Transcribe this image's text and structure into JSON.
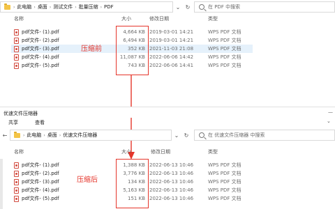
{
  "colors": {
    "accent_red": "#e5352b",
    "selected_row": "#e5f1fb",
    "folder": "#f3c447",
    "pdf_icon": "#d24a3e"
  },
  "top": {
    "breadcrumb": [
      "此电脑",
      "桌面",
      "测试文件",
      "批量压缩",
      "PDF"
    ],
    "search_placeholder": "在 PDF 中搜索",
    "columns": {
      "name": "名称",
      "size": "大小",
      "modified": "修改日期",
      "type": "类型"
    },
    "files": [
      {
        "name": "pdf文件- (1).pdf",
        "size": "4,664 KB",
        "modified": "2019-03-01 14:21",
        "type": "WPS PDF 文档"
      },
      {
        "name": "pdf文件- (2).pdf",
        "size": "6,494 KB",
        "modified": "2019-03-01 14:21",
        "type": "WPS PDF 文档"
      },
      {
        "name": "pdf文件- (3).pdf",
        "size": "352 KB",
        "modified": "2021-11-03 21:08",
        "type": "WPS PDF 文档",
        "selected": true
      },
      {
        "name": "pdf文件- (4).pdf",
        "size": "11,087 KB",
        "modified": "2022-06-06 14:42",
        "type": "WPS PDF 文档"
      },
      {
        "name": "pdf文件- (5).pdf",
        "size": "743 KB",
        "modified": "2022-06-06 14:41",
        "type": "WPS PDF 文档"
      }
    ],
    "label": "压缩前"
  },
  "bottom": {
    "window_title": "优速文件压缩器",
    "ribbon_tabs": [
      "共享",
      "查看"
    ],
    "breadcrumb": [
      "此电脑",
      "桌面",
      "优速文件压缩器"
    ],
    "search_placeholder": "在 优速文件压缩器 中搜索",
    "columns": {
      "name": "名称",
      "size": "大小",
      "modified": "修改日期",
      "type": "类型"
    },
    "files": [
      {
        "name": "pdf文件- (1).pdf",
        "size": "1,388 KB",
        "modified": "2022-06-13 10:46",
        "type": "WPS PDF 文档"
      },
      {
        "name": "pdf文件- (2).pdf",
        "size": "3,776 KB",
        "modified": "2022-06-13 10:46",
        "type": "WPS PDF 文档"
      },
      {
        "name": "pdf文件- (3).pdf",
        "size": "134 KB",
        "modified": "2022-06-13 10:46",
        "type": "WPS PDF 文档"
      },
      {
        "name": "pdf文件- (4).pdf",
        "size": "5,163 KB",
        "modified": "2022-06-13 10:46",
        "type": "WPS PDF 文档"
      },
      {
        "name": "pdf文件- (5).pdf",
        "size": "151 KB",
        "modified": "2022-06-13 10:46",
        "type": "WPS PDF 文档"
      }
    ],
    "label": "压缩后"
  }
}
